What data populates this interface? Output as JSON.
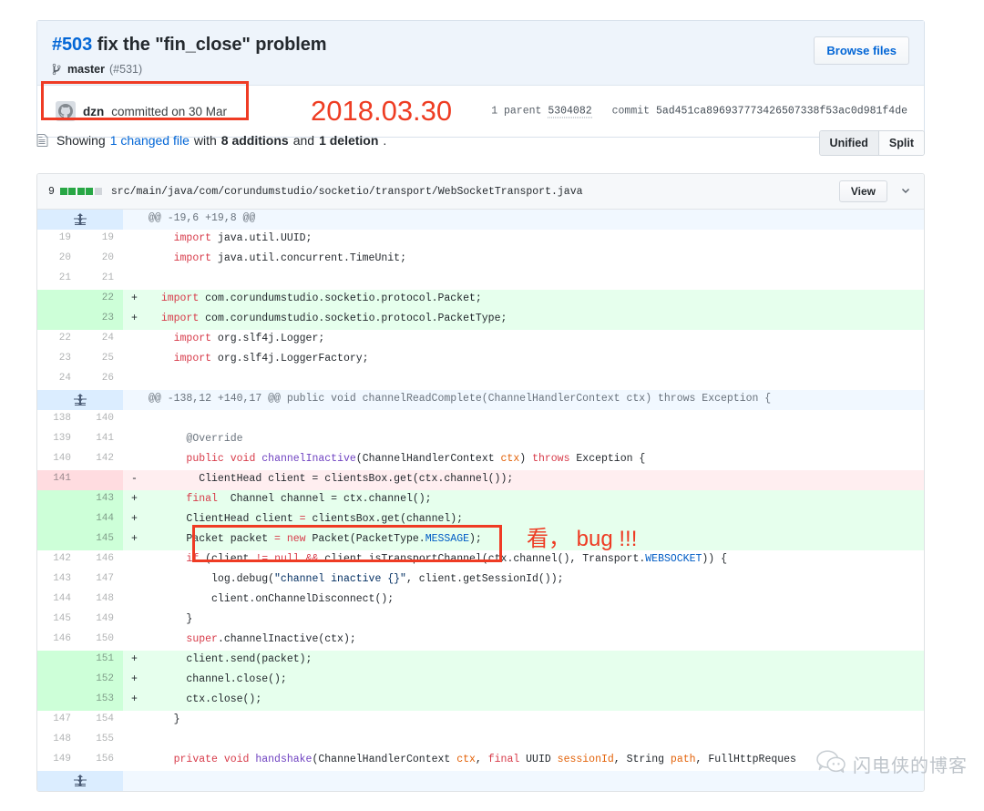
{
  "commit": {
    "number": "#503",
    "title": "fix the \"fin_close\" problem",
    "branch": "master",
    "pr_ref": "(#531)",
    "browse_files_label": "Browse files",
    "author": "dzn",
    "committed_text": "committed on 30 Mar",
    "annotation_date": "2018.03.30",
    "parent_label": "1 parent",
    "parent_sha": "5304082",
    "commit_label": "commit",
    "commit_sha": "5ad451ca896937773426507338f53ac0d981f4de"
  },
  "summary": {
    "prefix": "Showing",
    "changed_file": "1 changed file",
    "with": "with",
    "additions": "8 additions",
    "and": "and",
    "deletions": "1 deletion",
    "period": ".",
    "view_unified": "Unified",
    "view_split": "Split"
  },
  "file": {
    "stat_count": "9",
    "blocks": [
      "add",
      "add",
      "add",
      "add",
      "neutral"
    ],
    "path": "src/main/java/com/corundumstudio/socketio/transport/WebSocketTransport.java",
    "view_label": "View",
    "chevron": "⌄"
  },
  "annotations": {
    "bug_text": "看， bug !!!"
  },
  "watermark": {
    "text": "闪电侠的博客"
  },
  "diff": {
    "hunks": [
      {
        "header": "@@ -19,6 +19,8 @@",
        "rows": [
          {
            "type": "ctx",
            "old": "19",
            "new": "19",
            "mark": "",
            "html": "    <span class=\"k\">import</span> java.util.UUID;"
          },
          {
            "type": "ctx",
            "old": "20",
            "new": "20",
            "mark": "",
            "html": "    <span class=\"k\">import</span> java.util.concurrent.TimeUnit;"
          },
          {
            "type": "ctx",
            "old": "21",
            "new": "21",
            "mark": "",
            "html": ""
          },
          {
            "type": "add",
            "old": "",
            "new": "22",
            "mark": "+",
            "html": "  <span class=\"k\">import</span> com.corundumstudio.socketio.protocol.Packet;"
          },
          {
            "type": "add",
            "old": "",
            "new": "23",
            "mark": "+",
            "html": "  <span class=\"k\">import</span> com.corundumstudio.socketio.protocol.PacketType;"
          },
          {
            "type": "ctx",
            "old": "22",
            "new": "24",
            "mark": "",
            "html": "    <span class=\"k\">import</span> org.slf4j.Logger;"
          },
          {
            "type": "ctx",
            "old": "23",
            "new": "25",
            "mark": "",
            "html": "    <span class=\"k\">import</span> org.slf4j.LoggerFactory;"
          },
          {
            "type": "ctx",
            "old": "24",
            "new": "26",
            "mark": "",
            "html": ""
          }
        ]
      },
      {
        "header": "@@ -138,12 +140,17 @@ public void channelReadComplete(ChannelHandlerContext ctx) throws Exception {",
        "rows": [
          {
            "type": "ctx",
            "old": "138",
            "new": "140",
            "mark": "",
            "html": ""
          },
          {
            "type": "ctx",
            "old": "139",
            "new": "141",
            "mark": "",
            "html": "      <span class=\"an\">@Override</span>"
          },
          {
            "type": "ctx",
            "old": "140",
            "new": "142",
            "mark": "",
            "html": "      <span class=\"k\">public</span> <span class=\"k\">void</span> <span class=\"t\">channelInactive</span>(ChannelHandlerContext <span class=\"v\">ctx</span>) <span class=\"k\">throws</span> Exception {"
          },
          {
            "type": "del",
            "old": "141",
            "new": "",
            "mark": "-",
            "html": "        ClientHead client = clientsBox.get(ctx.channel());"
          },
          {
            "type": "add",
            "old": "",
            "new": "143",
            "mark": "+",
            "html": "      <span class=\"k\">final</span>  Channel channel = ctx.channel();"
          },
          {
            "type": "add",
            "old": "",
            "new": "144",
            "mark": "+",
            "html": "      ClientHead client <span class=\"k\">=</span> clientsBox.get(channel);"
          },
          {
            "type": "add",
            "old": "",
            "new": "145",
            "mark": "+",
            "html": "      Packet packet <span class=\"k\">=</span> <span class=\"k\">new</span> Packet(PacketType.<span class=\"cn\">MESSAGE</span>);"
          },
          {
            "type": "ctx",
            "old": "142",
            "new": "146",
            "mark": "",
            "html": "      <span class=\"k\">if</span> (client <span class=\"k\">!=</span> <span class=\"k\">null</span> <span class=\"k\">&amp;&amp;</span> client.isTransportChannel(ctx.channel(), Transport.<span class=\"cn\">WEBSOCKET</span>)) {"
          },
          {
            "type": "ctx",
            "old": "143",
            "new": "147",
            "mark": "",
            "html": "          log.debug(<span class=\"s\">\"channel inactive {}\"</span>, client.getSessionId());"
          },
          {
            "type": "ctx",
            "old": "144",
            "new": "148",
            "mark": "",
            "html": "          client.onChannelDisconnect();"
          },
          {
            "type": "ctx",
            "old": "145",
            "new": "149",
            "mark": "",
            "html": "      }"
          },
          {
            "type": "ctx",
            "old": "146",
            "new": "150",
            "mark": "",
            "html": "      <span class=\"k\">super</span>.channelInactive(ctx);"
          },
          {
            "type": "add",
            "old": "",
            "new": "151",
            "mark": "+",
            "html": "      client.send(packet);"
          },
          {
            "type": "add",
            "old": "",
            "new": "152",
            "mark": "+",
            "html": "      channel.close();"
          },
          {
            "type": "add",
            "old": "",
            "new": "153",
            "mark": "+",
            "html": "      ctx.close();"
          },
          {
            "type": "ctx",
            "old": "147",
            "new": "154",
            "mark": "",
            "html": "    }"
          },
          {
            "type": "ctx",
            "old": "148",
            "new": "155",
            "mark": "",
            "html": ""
          },
          {
            "type": "ctx",
            "old": "149",
            "new": "156",
            "mark": "",
            "html": "    <span class=\"k\">private</span> <span class=\"k\">void</span> <span class=\"t\">handshake</span>(ChannelHandlerContext <span class=\"v\">ctx</span>, <span class=\"k\">final</span> UUID <span class=\"v\">sessionId</span>, String <span class=\"v\">path</span>, FullHttpReques"
          }
        ]
      }
    ],
    "footer_unfold": true
  }
}
